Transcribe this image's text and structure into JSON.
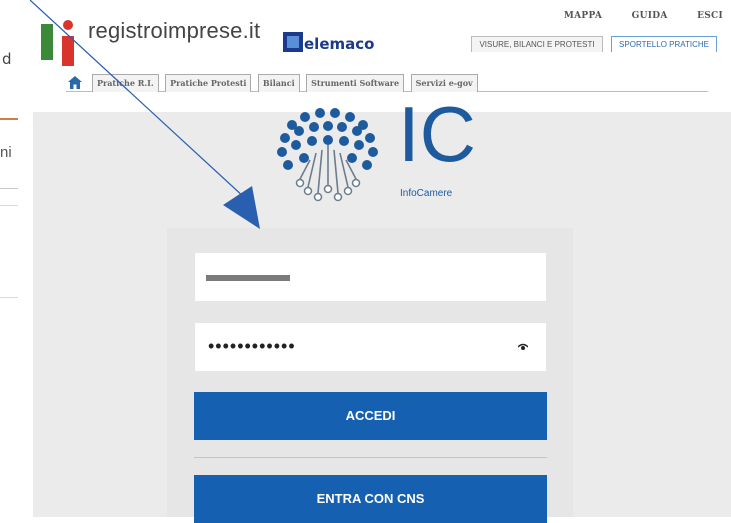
{
  "background_page": {
    "fragment_top": "d",
    "fragment_mid": "ni"
  },
  "header": {
    "brand": "registroimprese.it",
    "telemaco": "elemaco",
    "top_links": [
      "MAPPA",
      "GUIDA",
      "ESCI"
    ],
    "top_tabs": [
      {
        "label": "VISURE, BILANCI E PROTESTI",
        "active": false
      },
      {
        "label": "SPORTELLO PRATICHE",
        "active": true
      }
    ],
    "menu_tabs": [
      "Pratiche R.I.",
      "Pratiche Protesti",
      "Bilanci",
      "Strumenti Software",
      "Servizi e-gov"
    ]
  },
  "login": {
    "logo_letters": "IC",
    "logo_caption": "InfoCamere",
    "password_dots": "••••••••••••",
    "accedi_label": "ACCEDI",
    "cns_label": "ENTRA CON CNS"
  },
  "colors": {
    "primary_button": "#1560b0",
    "brand_blue": "#1e5b9e",
    "arrow": "#2a5fb0"
  }
}
